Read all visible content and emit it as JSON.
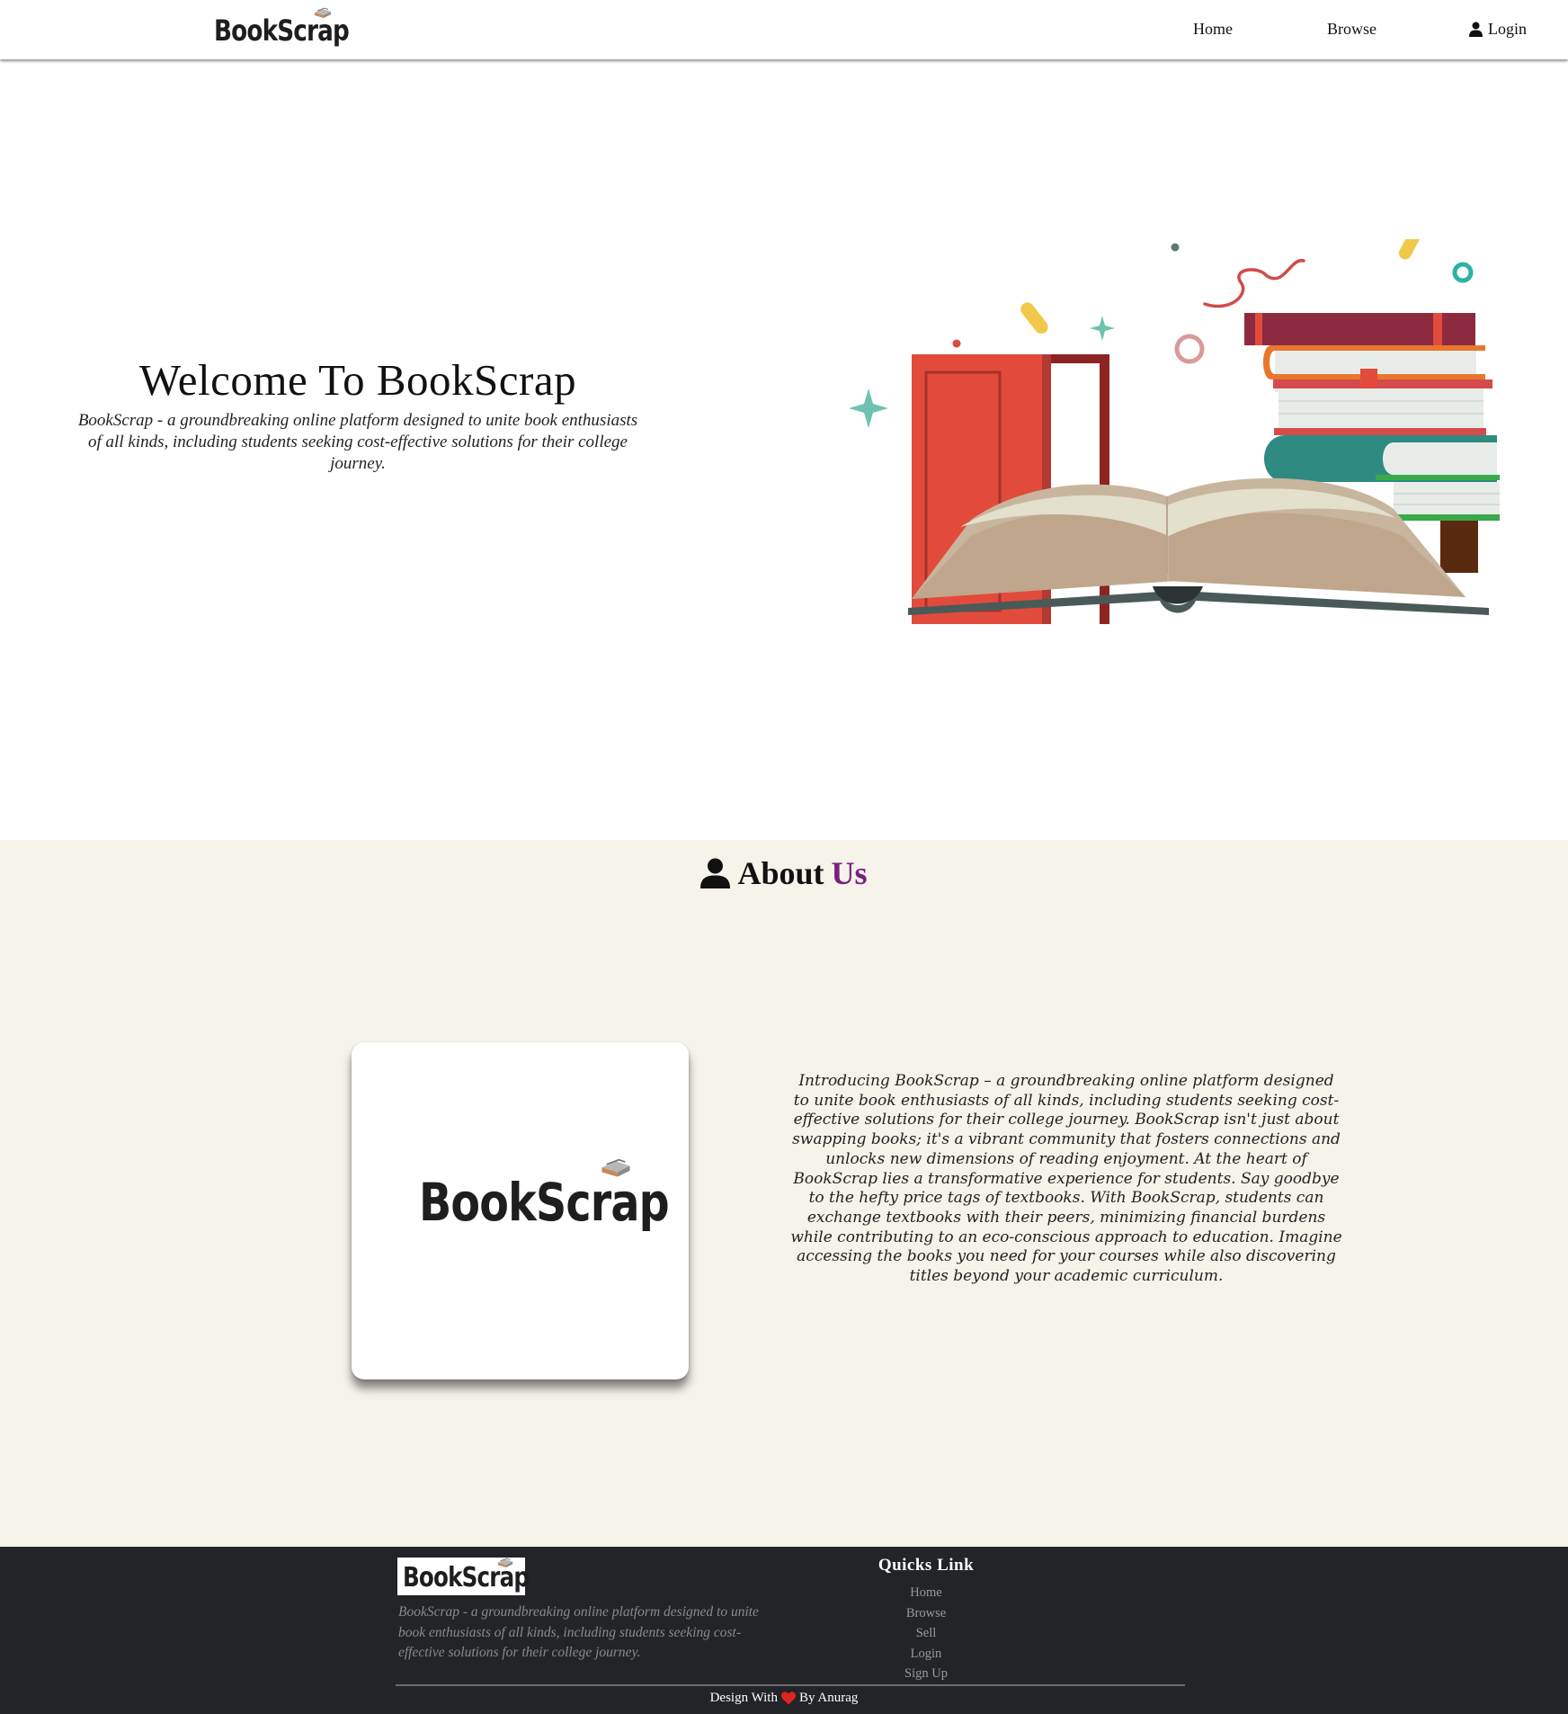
{
  "brand": {
    "name": "BookScrap"
  },
  "nav": {
    "links": [
      {
        "label": "Home"
      },
      {
        "label": "Browse"
      },
      {
        "label": "Login",
        "icon": "user-icon"
      }
    ]
  },
  "hero": {
    "title": "Welcome To BookScrap",
    "subtitle": "BookScrap - a groundbreaking online platform designed to unite book enthusiasts of all kinds, including students seeking cost-effective solutions for their college journey."
  },
  "about": {
    "heading_prefix": "About",
    "heading_accent": "Us",
    "heading_icon": "user-icon",
    "body": "Introducing BookScrap – a groundbreaking online platform designed to unite book enthusiasts of all kinds, including students seeking cost-effective solutions for their college journey. BookScrap isn't just about swapping books; it's a vibrant community that fosters connections and unlocks new dimensions of reading enjoyment. At the heart of BookScrap lies a transformative experience for students. Say goodbye to the hefty price tags of textbooks. With BookScrap, students can exchange textbooks with their peers, minimizing financial burdens while contributing to an eco-conscious approach to education. Imagine accessing the books you need for your courses while also discovering titles beyond your academic curriculum."
  },
  "footer": {
    "description": "BookScrap - a groundbreaking online platform designed to unite book enthusiasts of all kinds, including students seeking cost-effective solutions for their college journey.",
    "quick_links_title": "Quicks Link",
    "quick_links": [
      "Home",
      "Browse",
      "Sell",
      "Login",
      "Sign Up"
    ],
    "credit_prefix": "Design With",
    "credit_suffix": "By Anurag",
    "credit_icon": "heart-icon"
  },
  "colors": {
    "about_bg": "#f5f3ea",
    "accent": "#7a1f7e",
    "footer_bg": "#232427",
    "heart": "#e02424"
  }
}
